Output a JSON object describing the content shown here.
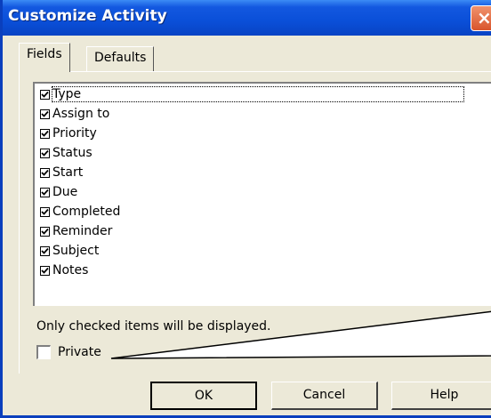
{
  "window": {
    "title": "Customize Activity",
    "close_glyph": "×"
  },
  "tabs": [
    {
      "label": "Fields",
      "active": true
    },
    {
      "label": "Defaults",
      "active": false
    }
  ],
  "fields": [
    {
      "label": "Type",
      "checked": true
    },
    {
      "label": "Assign to",
      "checked": true
    },
    {
      "label": "Priority",
      "checked": true
    },
    {
      "label": "Status",
      "checked": true
    },
    {
      "label": "Start",
      "checked": true
    },
    {
      "label": "Due",
      "checked": true
    },
    {
      "label": "Completed",
      "checked": true
    },
    {
      "label": "Reminder",
      "checked": true
    },
    {
      "label": "Subject",
      "checked": true
    },
    {
      "label": "Notes",
      "checked": true
    }
  ],
  "note": "Only checked items will be displayed.",
  "private": {
    "label": "Private",
    "checked": false
  },
  "buttons": {
    "ok": "OK",
    "cancel": "Cancel",
    "help": "Help"
  }
}
